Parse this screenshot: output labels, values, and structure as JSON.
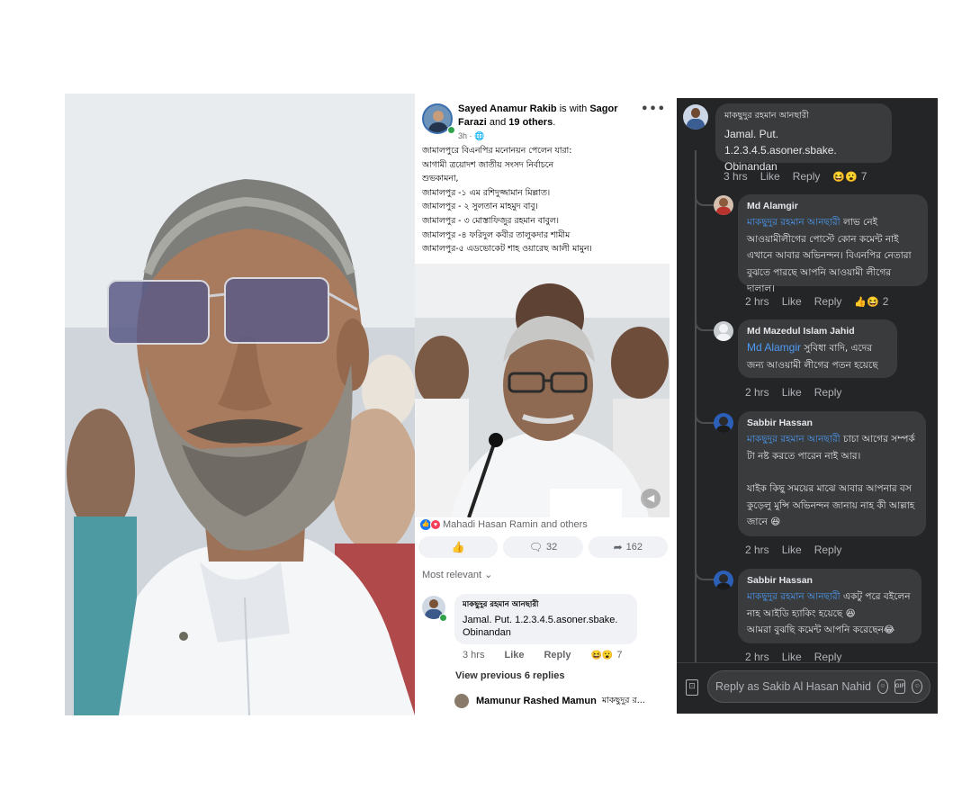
{
  "post": {
    "author": "Sayed Anamur Rakib",
    "with_text": "is with",
    "tagged": "Sagor Farazi",
    "and_text": "and",
    "others": "19 others",
    "time": "3h",
    "more_label": "•••",
    "lines": [
      "জামালপুরে বিএনপির মনোনয়ন পেলেন যারা:",
      "আগামী ত্রয়োদশ জাতীয় সংসদ নির্বাচনে",
      "শুভকামনা,",
      "জামালপুর -১ এম রশিদুজ্জামান মিল্লাত।",
      "জামালপুর - ২ সুলতান মাহমুদ বাবু।",
      "জামালপুর - ৩ মোস্তাফিজুর রহমান বাবুল।",
      "জামালপুর -৪ ফরিদুল কবীর তালুকদার শামীম",
      "জামালপুর-৫ এডভোকেট শাহ ওয়ারেছ আলী মামুন।"
    ],
    "reactions_text": "Mahadi Hasan Ramin and others",
    "comment_count": "32",
    "share_count": "162",
    "sort_label": "Most relevant",
    "comment": {
      "name": "মাকছুদুর রহমান আনছারী",
      "text": "Jamal. Put. 1.2.3.4.5.asoner.sbake. Obinandan",
      "time": "3 hrs",
      "like": "Like",
      "reply": "Reply",
      "reaction_count": "7"
    },
    "view_previous": "View previous 6 replies",
    "reply_preview": {
      "name": "Mamunur Rashed Mamun",
      "text": "মাকছুদুর র..."
    }
  },
  "dark": {
    "comments": [
      {
        "name": "মাকছুদুর রহমান আনছারী",
        "text": "Jamal. Put. 1.2.3.4.5.asoner.sbake. Obinandan",
        "time": "3 hrs",
        "like": "Like",
        "reply": "Reply",
        "reaction_count": "7"
      },
      {
        "name": "Md Alamgir",
        "mention": "মাকছুদুর রহমান আনছারী",
        "text": "লাভ নেই আওয়ামীলীগের পোস্টে কোন কমেন্ট নাই এখানে আবার অভিনন্দন। বিএনপির নেতারা বুঝতে পারছে আপনি আওয়ামী লীগের দালাল।",
        "time": "2 hrs",
        "like": "Like",
        "reply": "Reply",
        "reaction_count": "2"
      },
      {
        "name": "Md Mazedul Islam Jahid",
        "mention": "Md Alamgir",
        "text": "সুবিধা বাদি, এদের জন্য আওয়ামী লীগের পতন হয়েছে",
        "time": "2 hrs",
        "like": "Like",
        "reply": "Reply"
      },
      {
        "name": "Sabbir Hassan",
        "mention": "মাকছুদুর রহমান আনছারী",
        "text": "চাচা আগের সম্পর্ক টা নষ্ট করতে পারেন নাই আর।",
        "text2": "যাইক কিছু সময়ের মাঝে আবার আপনার বস কুড়েলু মুন্সি অভিনন্দন জানায় নাহ কী আল্লাহ জানে 😆",
        "time": "2 hrs",
        "like": "Like",
        "reply": "Reply"
      },
      {
        "name": "Sabbir Hassan",
        "mention": "মাকছুদুর রহমান আনছারী",
        "text": "একটু পরে বইলেন নাহ আইডি হ্যাকিং হয়েছে 😆",
        "text2": "আমরা বুঝছি কমেন্ট আপনি করেছেন😂",
        "time": "2 hrs",
        "like": "Like",
        "reply": "Reply"
      }
    ],
    "reply_placeholder": "Reply as Sakib Al Hasan Nahid",
    "gif_label": "GIF"
  }
}
